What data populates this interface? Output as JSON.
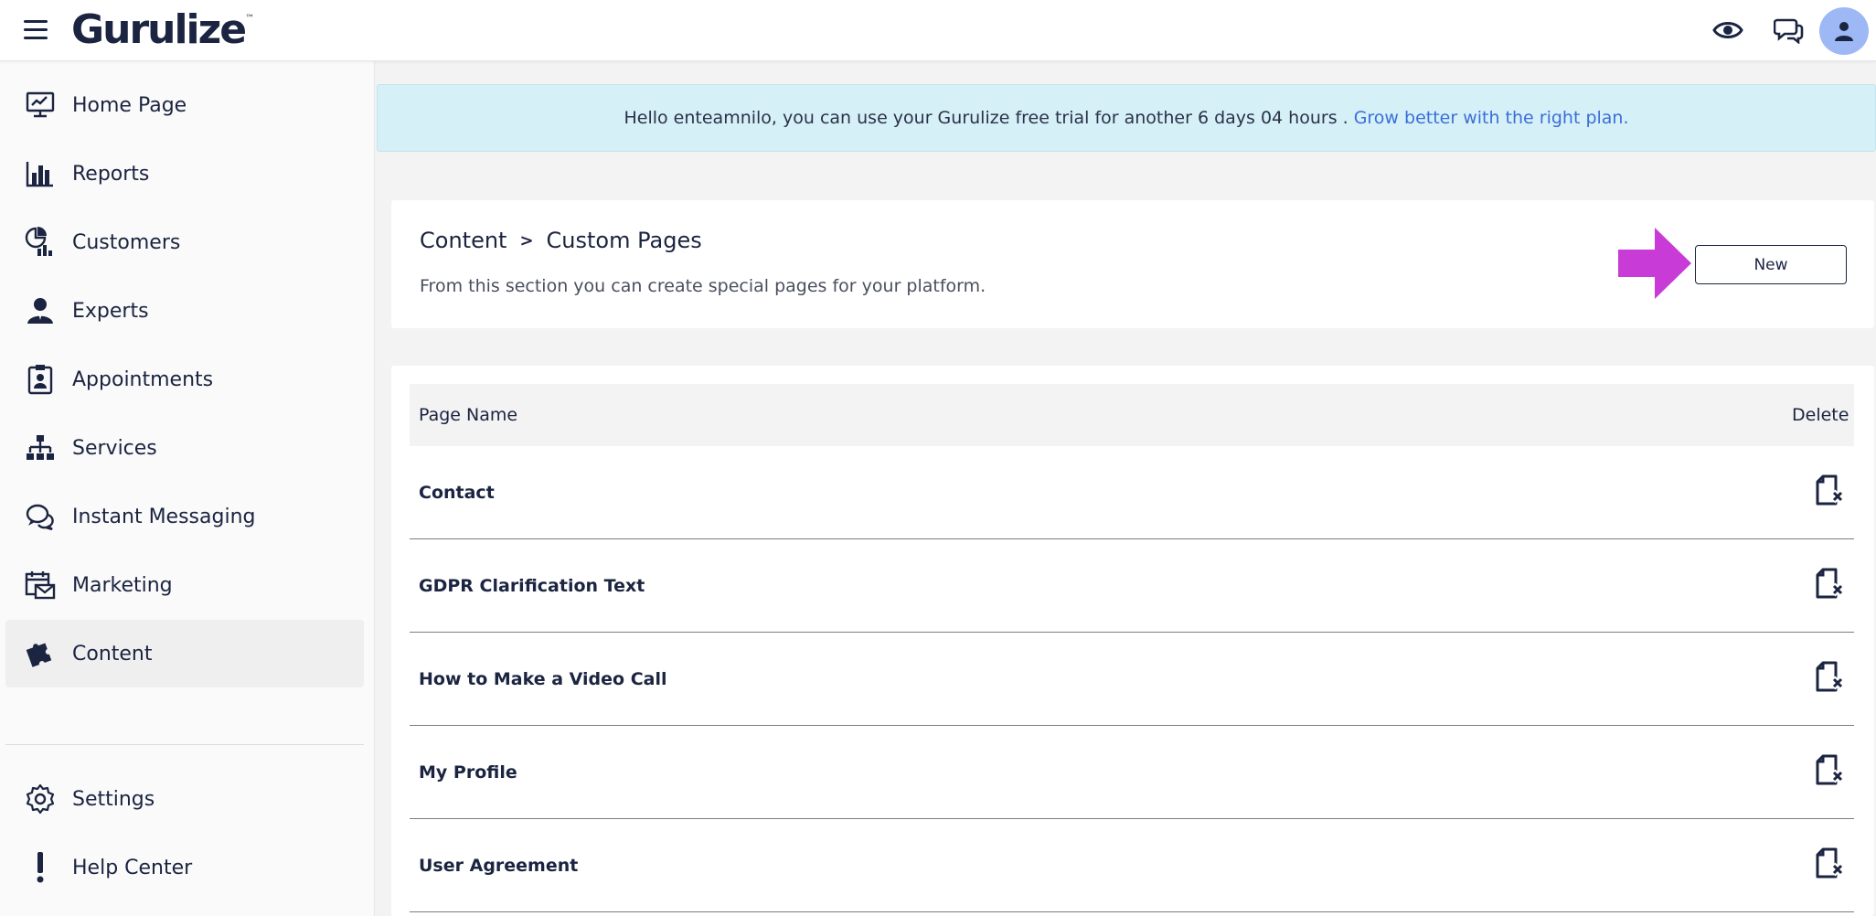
{
  "app": {
    "logo_text": "Gurulize",
    "logo_mark": "™"
  },
  "topbar": {
    "icons": [
      "menu-icon",
      "eye-icon",
      "chat-icon",
      "user-icon"
    ]
  },
  "sidebar": {
    "items": [
      {
        "label": "Home Page",
        "icon": "monitor-chart-icon"
      },
      {
        "label": "Reports",
        "icon": "bar-chart-icon"
      },
      {
        "label": "Customers",
        "icon": "pie-users-icon"
      },
      {
        "label": "Experts",
        "icon": "expert-user-icon"
      },
      {
        "label": "Appointments",
        "icon": "clipboard-user-icon"
      },
      {
        "label": "Services",
        "icon": "hierarchy-icon"
      },
      {
        "label": "Instant Messaging",
        "icon": "chat-bubbles-icon"
      },
      {
        "label": "Marketing",
        "icon": "calendar-mail-icon"
      },
      {
        "label": "Content",
        "icon": "puzzle-icon",
        "active": true
      }
    ],
    "bottom_items": [
      {
        "label": "Settings",
        "icon": "gear-icon"
      },
      {
        "label": "Help Center",
        "icon": "exclamation-icon"
      }
    ]
  },
  "banner": {
    "text": "Hello enteamnilo, you can use your Gurulize free trial for another 6 days 04 hours .",
    "link": "Grow better with the right plan."
  },
  "header": {
    "breadcrumb": [
      "Content",
      "Custom Pages"
    ],
    "separator": ">",
    "description": "From this section you can create special pages for your platform.",
    "new_button": "New"
  },
  "table": {
    "columns": [
      "Page Name",
      "Delete"
    ],
    "rows": [
      {
        "name": "Contact"
      },
      {
        "name": "GDPR Clarification Text"
      },
      {
        "name": "How to Make a Video Call"
      },
      {
        "name": "My Profile"
      },
      {
        "name": "User Agreement"
      }
    ]
  },
  "colors": {
    "brand_navy": "#1b2440",
    "banner_bg": "#d6f0f8",
    "link": "#3b6ed8",
    "arrow": "#c93bd6",
    "avatar_bg": "#9db8f4"
  }
}
